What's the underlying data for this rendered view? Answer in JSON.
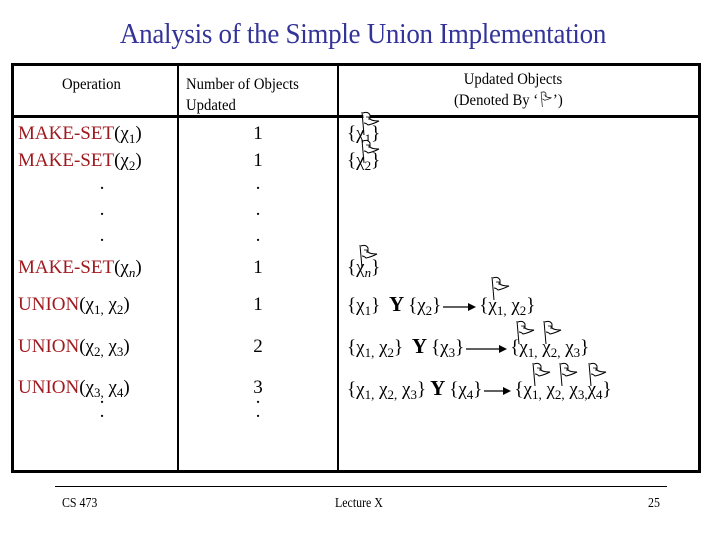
{
  "title": "Analysis of the Simple Union Implementation",
  "table": {
    "headers": {
      "operation": "Operation",
      "count_line1": "Number of Objects",
      "count_line2": "Updated",
      "updated_line1": "Updated Objects",
      "updated_line2_prefix": "(Denoted By ‘",
      "updated_line2_suffix": "’)",
      "flag_icon": "flag-icon"
    },
    "make_set_rows": [
      {
        "op": "MAKE-SET",
        "arg": "χ",
        "sub": "1",
        "count": "1",
        "set": "{χ",
        "set_sub": "1",
        "set_close": "}"
      },
      {
        "op": "MAKE-SET",
        "arg": "χ",
        "sub": "2",
        "count": "1",
        "set": "{χ",
        "set_sub": "2",
        "set_close": "}"
      },
      {
        "op": "MAKE-SET",
        "arg": "χ",
        "sub": "n",
        "count": "1",
        "set": "{χ",
        "set_sub": "n",
        "set_close": "}"
      }
    ],
    "ellipsis": "·",
    "union_rows": [
      {
        "op": "UNION",
        "args": "(χ",
        "s1": "1,",
        "mid": " χ",
        "s2": "2",
        "close": ")",
        "count": "1",
        "left": "{χ",
        "left_sub": "1",
        "left_close": "}",
        "cup": "Y",
        "right": "{χ",
        "right_sub": "2",
        "right_close": "}",
        "result": "{χ",
        "result_sub": "1,",
        "result_mid": " χ",
        "result_sub2": "2",
        "result_close": "}"
      },
      {
        "op": "UNION",
        "args": "(χ",
        "s1": "2,",
        "mid": " χ",
        "s2": "3",
        "close": ")",
        "count": "2",
        "left": "{χ",
        "left_sub": "1,",
        "left_mid": " χ",
        "left_sub2": "2",
        "left_close": "}",
        "cup": "Y",
        "right": "{χ",
        "right_sub": "3",
        "right_close": "}",
        "result": "{χ",
        "result_sub": "1,",
        "result_mid": " χ",
        "result_sub2": "2,",
        "result_mid2": " χ",
        "result_sub3": "3",
        "result_close": "}"
      },
      {
        "op": "UNION",
        "args": "(χ",
        "s1": "3,",
        "mid": " χ",
        "s2": "4",
        "close": ")",
        "count": "3",
        "left": "{χ",
        "left_sub": "1,",
        "left_mid": " χ",
        "left_sub2": "2,",
        "left_mid2": " χ",
        "left_sub3": "3",
        "left_close": "}",
        "cup": "Y",
        "right": "{χ",
        "right_sub": "4",
        "right_close": "}",
        "result": "{χ",
        "result_sub": "1,",
        "result_mid": " χ",
        "result_sub2": "2,",
        "result_mid2": " χ",
        "result_sub3": "3,",
        "result_mid3": "χ",
        "result_sub4": "4",
        "result_close": "}"
      }
    ]
  },
  "footer": {
    "course": "CS 473",
    "lecture": "Lecture X",
    "page": "25"
  }
}
